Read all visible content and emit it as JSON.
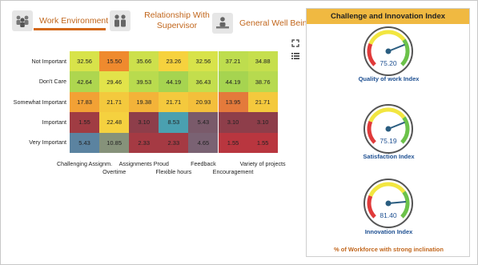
{
  "tabs": [
    {
      "label": "Work Environment",
      "active": true,
      "icon": "people-group-icon"
    },
    {
      "label": "Relationship With Supervisor",
      "active": false,
      "icon": "supervisor-icon"
    },
    {
      "label": "General Well Being",
      "active": false,
      "icon": "person-desk-icon"
    }
  ],
  "heatmap": {
    "rows": [
      "Not Important",
      "Don't Care",
      "Somewhat Important",
      "Important",
      "Very Important"
    ],
    "columns": [
      "Challenging Assignm.",
      "Overtime",
      "Assignments Proud",
      "Flexible hours",
      "Feedback",
      "Encouragement",
      "Variety of projects"
    ],
    "values": [
      [
        "32.56",
        "15.50",
        "35.66",
        "23.26",
        "32.56",
        "37.21",
        "34.88"
      ],
      [
        "42.64",
        "29.46",
        "39.53",
        "44.19",
        "36.43",
        "44.19",
        "38.76"
      ],
      [
        "17.83",
        "21.71",
        "19.38",
        "21.71",
        "20.93",
        "13.95",
        "21.71"
      ],
      [
        "1.55",
        "22.48",
        "3.10",
        "8.53",
        "5.43",
        "3.10",
        "3.10"
      ],
      [
        "5.43",
        "10.85",
        "2.33",
        "2.33",
        "4.65",
        "1.55",
        "1.55"
      ]
    ],
    "colors": [
      [
        "#d8e34a",
        "#ef8a2e",
        "#cde04c",
        "#f6d23e",
        "#d8e34a",
        "#bedd4e",
        "#c6df4d"
      ],
      [
        "#aed64f",
        "#e2e34a",
        "#b9db4e",
        "#a6d450",
        "#c3de4d",
        "#a6d450",
        "#b7da4f"
      ],
      [
        "#f2a135",
        "#f4c93d",
        "#f3b339",
        "#f4c93d",
        "#f3bf3b",
        "#e47a3b",
        "#f4c93d"
      ],
      [
        "#a03c43",
        "#f5d13f",
        "#8e3e4a",
        "#4aa0b0",
        "#7a5a6a",
        "#8e3e4a",
        "#8e3e4a"
      ],
      [
        "#5b83a0",
        "#86927a",
        "#a53a43",
        "#a53a43",
        "#7a6273",
        "#b9363f",
        "#b9363f"
      ]
    ]
  },
  "tools": {
    "expand_icon": "expand-icon",
    "menu_icon": "list-menu-icon"
  },
  "panel": {
    "title": "Challenge and Innovation Index",
    "gauges": [
      {
        "label": "Quality of work Index",
        "value": "75.20",
        "fraction": 0.752
      },
      {
        "label": "Satisfaction Index",
        "value": "75.19",
        "fraction": 0.7519
      },
      {
        "label": "Innovation Index",
        "value": "81.40",
        "fraction": 0.814
      }
    ],
    "footer": "% of Workforce with strong inclination"
  }
}
